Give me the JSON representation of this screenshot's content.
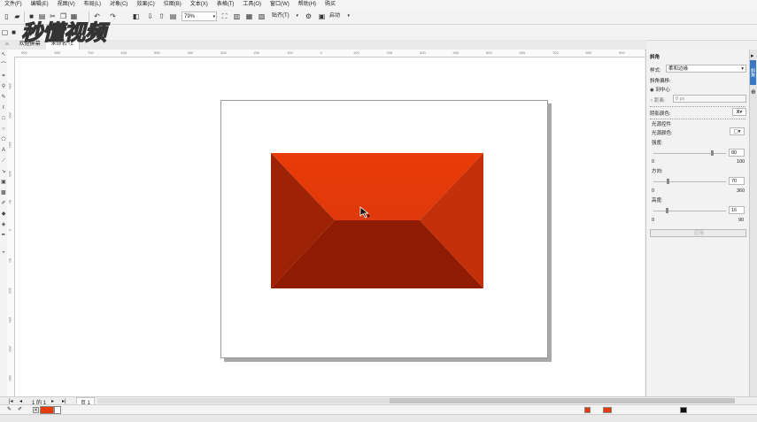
{
  "menu": [
    "文件(F)",
    "编辑(E)",
    "视图(V)",
    "布局(L)",
    "对象(C)",
    "效果(C)",
    "位图(B)",
    "文本(X)",
    "表格(T)",
    "工具(O)",
    "窗口(W)",
    "帮助(H)",
    "购买"
  ],
  "toolbar": {
    "zoom": "79%",
    "snap_label": "贴齐(T)",
    "launch_label": "启动"
  },
  "tabs": [
    "欢迎屏幕",
    "未命名 -1"
  ],
  "watermark_text": "秒懂视频",
  "ruler": {
    "h": [
      "900",
      "800",
      "700",
      "600",
      "500",
      "400",
      "300",
      "200",
      "100",
      "0",
      "100",
      "200",
      "300",
      "400",
      "500",
      "600",
      "700",
      "800",
      "900"
    ],
    "v": [
      "250",
      "200",
      "150",
      "100",
      "50",
      "0",
      "50",
      "100",
      "150",
      "200",
      "250"
    ]
  },
  "docker": {
    "title": "斜角",
    "style_label": "样式:",
    "style_value": "柔和边缘",
    "offset_label": "斜角偏移:",
    "to_center_label": "到中心",
    "distance_label": "距离:",
    "distance_value": "8 px",
    "shadow_color_label": "阴影颜色:",
    "light_controls_label": "光源控件",
    "light_color_label": "光源颜色:",
    "intensity_label": "强度:",
    "intensity_value": "80",
    "intensity_min": "0",
    "intensity_max": "100",
    "direction_label": "方向:",
    "direction_value": "70",
    "direction_min": "0",
    "direction_max": "360",
    "altitude_label": "高度:",
    "altitude_value": "16",
    "altitude_min": "0",
    "altitude_max": "90",
    "apply_label": "应用",
    "side_tab": "斜角"
  },
  "page_nav": {
    "page_count": "1 的 1",
    "page_tab": "页 1"
  },
  "colors": {
    "shape_top": "#e53a0a",
    "shape_side": "#b52a07",
    "shape_bottom": "#8f1a03",
    "fill_swatch": "#e53a0a"
  }
}
